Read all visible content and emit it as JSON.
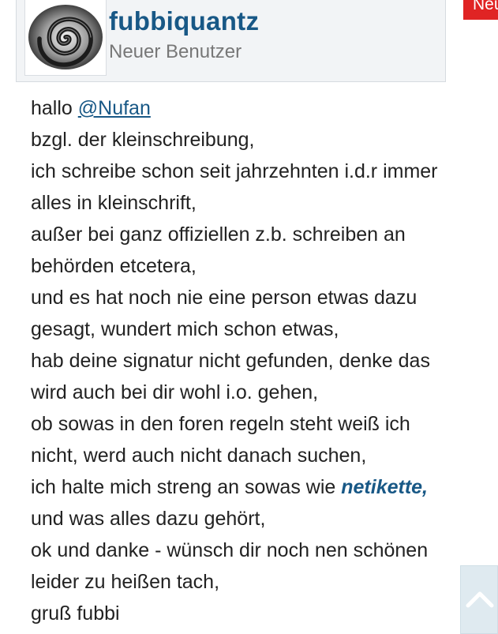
{
  "user": {
    "name": "fubbiquantz",
    "title": "Neuer Benutzer",
    "avatar_icon": "spiral-avatar-icon"
  },
  "badge": {
    "label": "Neu",
    "color": "#e02424"
  },
  "post": {
    "greeting": "hallo ",
    "mention": "@Nufan",
    "lines": [
      "bzgl. der kleinschreibung,",
      "ich schreibe schon seit jahrzehnten i.d.r immer",
      "alles in kleinschrift,",
      "außer bei ganz offiziellen z.b. schreiben an",
      "behörden etcetera,",
      "und es hat noch nie eine person etwas dazu",
      "gesagt, wundert mich schon etwas,",
      "hab deine signatur nicht gefunden, denke das",
      "wird auch bei dir wohl i.o. gehen,",
      "ob sowas in den foren regeln steht weiß ich",
      "nicht, werd auch nicht danach suchen,"
    ],
    "emphasis_prefix": "ich halte mich streng an sowas wie ",
    "emphasis_word": "netikette,",
    "closing_lines": [
      "und was alles dazu gehört,",
      "ok und danke - wünsch dir noch nen schönen",
      "leider zu heißen tach,",
      "gruß fubbi"
    ]
  },
  "scroll_top": {
    "icon": "chevron-up-icon"
  },
  "colors": {
    "link": "#185886",
    "card_background": "#f2f4f6",
    "text": "#222222",
    "muted": "#777777"
  }
}
